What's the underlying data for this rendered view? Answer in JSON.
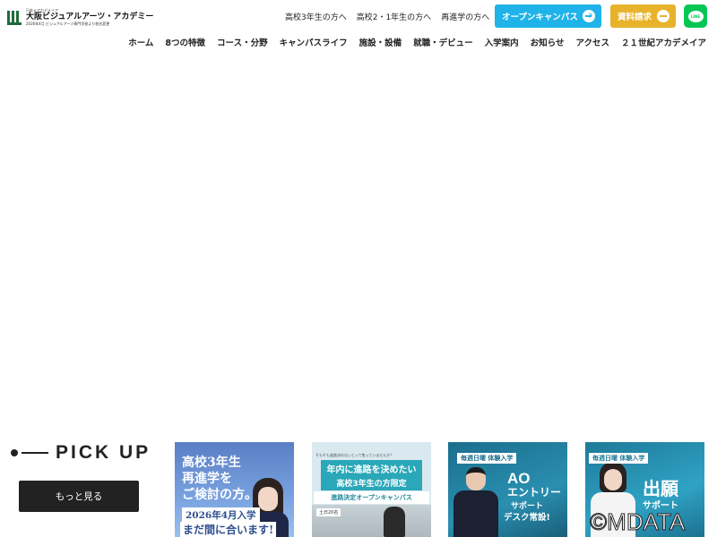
{
  "header": {
    "logo": {
      "small_text": "日本ｅアカデメイア",
      "main_text": "大阪ビジュアルアーツ・アカデミー",
      "sub_text": "2026年4月 ビジュアルアーツ専門学校より校名変更"
    },
    "top_links": [
      "高校3年生の方へ",
      "高校2・1年生の方へ",
      "再進学の方へ"
    ],
    "open_campus_label": "オープンキャンパス",
    "request_docs_label": "資料請求",
    "line_label": "LINE"
  },
  "nav": {
    "items": [
      "ホーム",
      "8つの特徴",
      "コース・分野",
      "キャンパスライフ",
      "施設・設備",
      "就職・デビュー",
      "入学案内",
      "お知らせ",
      "アクセス",
      "２１世紀アカデメイア"
    ]
  },
  "pickup": {
    "title": "PICK UP",
    "more_label": "もっと見る",
    "cards": [
      {
        "lines": [
          "高校3年生",
          "再進学を",
          "ご検討の方。",
          "2026年4月入学",
          "まだ間に合います!"
        ]
      },
      {
        "lines": [
          "そもそも進路決めないとって焦っていませんか？",
          "年内に進路を決めたい",
          "高校3年生の方限定",
          "進路決定オープンキャンパス",
          "土日20名"
        ]
      },
      {
        "lines": [
          "毎週日曜 体験入学",
          "AO",
          "エントリー",
          "サポート",
          "デスク常設!"
        ]
      },
      {
        "lines": [
          "毎週日曜 体験入学",
          "出願",
          "サポート"
        ]
      }
    ]
  },
  "watermark": "©MDATA",
  "colors": {
    "open_campus": "#1fb3e9",
    "request_docs": "#e8b32b",
    "line": "#06c755",
    "logo_green": "#1f6b3a"
  }
}
